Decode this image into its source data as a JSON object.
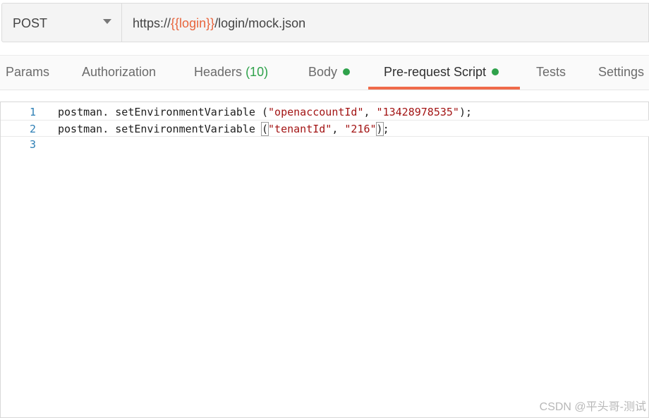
{
  "request": {
    "method": "POST",
    "url_prefix": "https://",
    "url_variable": "{{login}}",
    "url_suffix": "/login/mock.json"
  },
  "tabs": [
    {
      "label": "Params"
    },
    {
      "label": "Authorization"
    },
    {
      "label": "Headers",
      "count": "(10)"
    },
    {
      "label": "Body",
      "indicator": "green-dot"
    },
    {
      "label": "Pre-request Script",
      "indicator": "green-dot",
      "active": true
    },
    {
      "label": "Tests"
    },
    {
      "label": "Settings"
    }
  ],
  "editor": {
    "lines": [
      {
        "number": "1",
        "prefix": "postman. setEnvironmentVariable (",
        "arg1": "\"openaccountId\"",
        "sep": ", ",
        "arg2": "\"13428978535\"",
        "suffix": ");"
      },
      {
        "number": "2",
        "prefix": "postman. setEnvironmentVariable ",
        "open": "(",
        "arg1": "\"tenantId\"",
        "sep": ", ",
        "arg2": "\"216\"",
        "close": ")",
        "suffix": ";"
      },
      {
        "number": "3"
      }
    ]
  },
  "watermark": "CSDN @平头哥-测试",
  "colors": {
    "url_variable": "#e8643c",
    "active_tab_underline": "#ef6a4a",
    "indicator_dot": "#2fa24b",
    "string_literal": "#a31515",
    "line_number": "#2d7fb5"
  }
}
